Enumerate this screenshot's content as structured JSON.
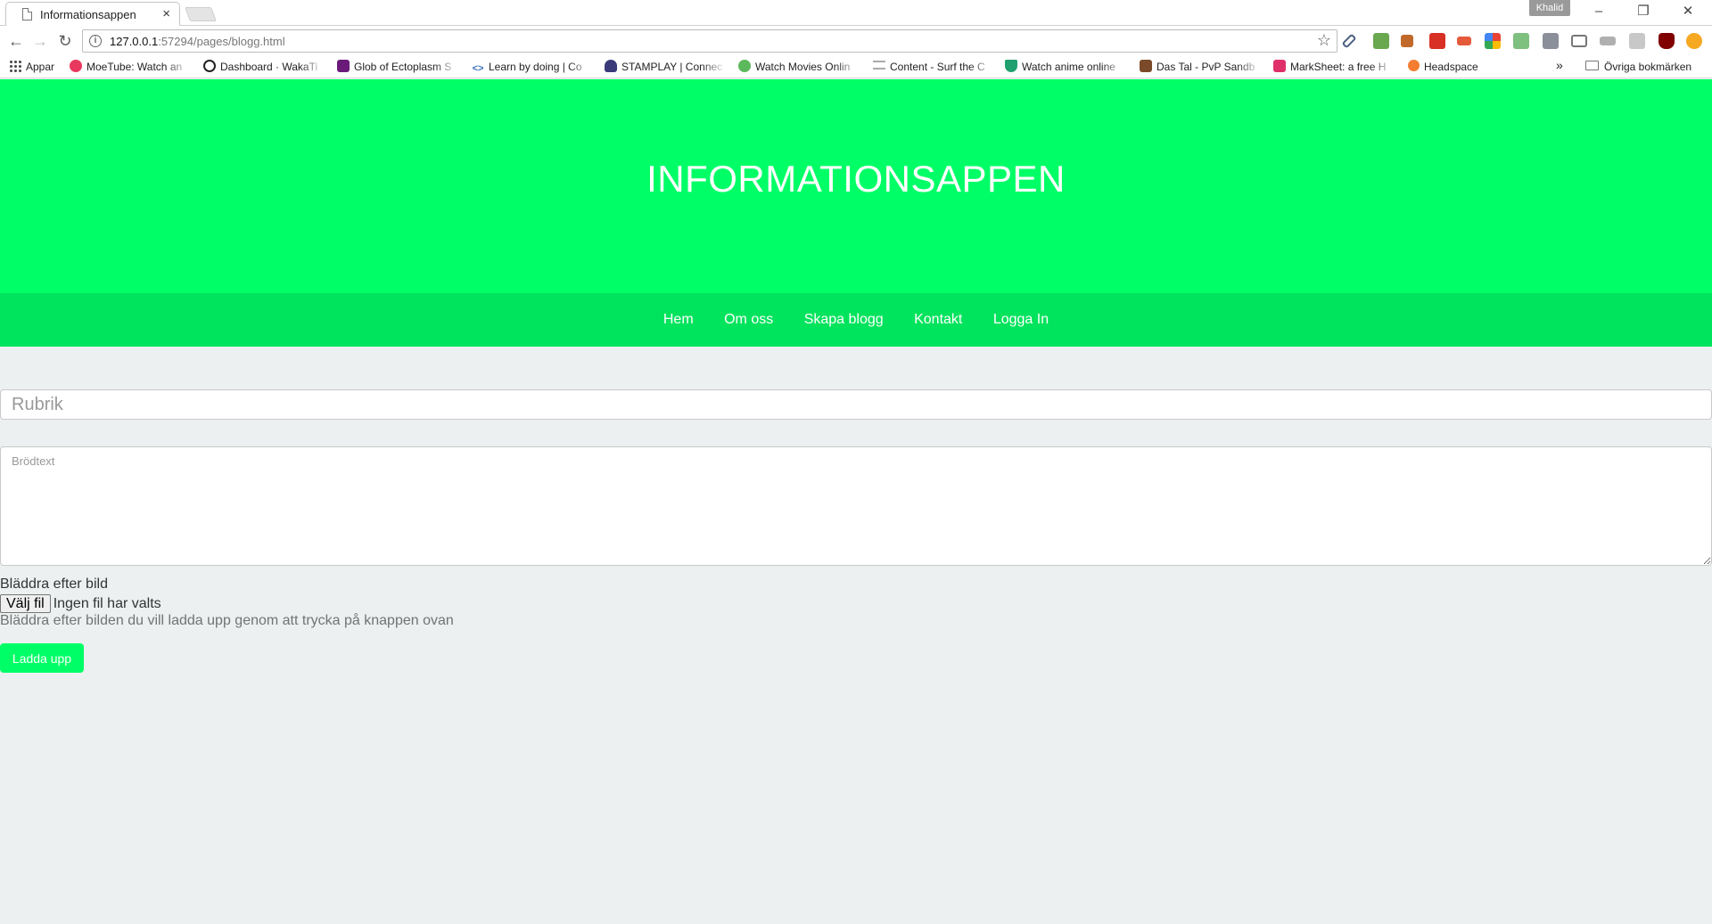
{
  "browser": {
    "tab": {
      "title": "Informationsappen",
      "close_glyph": "×"
    },
    "profile": "Khalid",
    "window_controls": {
      "minimize": "–",
      "restore": "❐",
      "close": "✕"
    },
    "nav_glyphs": {
      "back": "←",
      "forward": "→",
      "reload": "↻"
    },
    "address": {
      "host": "127.0.0.1",
      "rest": ":57294/pages/blogg.html",
      "info_glyph": "i",
      "star_glyph": "☆"
    },
    "bookmarks": [
      {
        "label": "Appar",
        "icon": "apps-grid-icon",
        "color": "#555555"
      },
      {
        "label": "MoeTube: Watch an",
        "icon": "moetube-icon",
        "color": "#e8385d"
      },
      {
        "label": "Dashboard · WakaTi",
        "icon": "wakatime-icon",
        "color": "#222222"
      },
      {
        "label": "Glob of Ectoplasm S",
        "icon": "ectoplasm-icon",
        "color": "#6a1b7a"
      },
      {
        "label": "Learn by doing | Co",
        "icon": "code-icon",
        "color": "#3b6fb6"
      },
      {
        "label": "STAMPLAY | Connec",
        "icon": "stamplay-icon",
        "color": "#3a3a7a"
      },
      {
        "label": "Watch Movies Onlin",
        "icon": "play-icon",
        "color": "#5cb85c"
      },
      {
        "label": "Content - Surf the C",
        "icon": "content-icon",
        "color": "#9a9a9a"
      },
      {
        "label": "Watch anime online",
        "icon": "anime-icon",
        "color": "#20a070"
      },
      {
        "label": "Das Tal - PvP Sandb",
        "icon": "dastal-icon",
        "color": "#7a4a2a"
      },
      {
        "label": "MarkSheet: a free H",
        "icon": "marksheet-icon",
        "color": "#e0306a"
      },
      {
        "label": "Headspace",
        "icon": "headspace-icon",
        "color": "#f47d31"
      }
    ],
    "overflow_glyph": "»",
    "other_bookmarks": "Övriga bokmärken"
  },
  "site": {
    "title": "INFORMATIONSAPPEN",
    "colors": {
      "hero": "#00ff66",
      "nav": "#00e35c",
      "background": "#ecf0f1"
    },
    "nav": [
      "Hem",
      "Om oss",
      "Skapa blogg",
      "Kontakt",
      "Logga In"
    ]
  },
  "form": {
    "title_placeholder": "Rubrik",
    "body_placeholder": "Brödtext",
    "file_label": "Bläddra efter bild",
    "file_button": "Välj fil",
    "file_status": "Ingen fil har valts",
    "file_help": "Bläddra efter bilden du vill ladda upp genom att trycka på knappen ovan",
    "submit_label": "Ladda upp"
  }
}
